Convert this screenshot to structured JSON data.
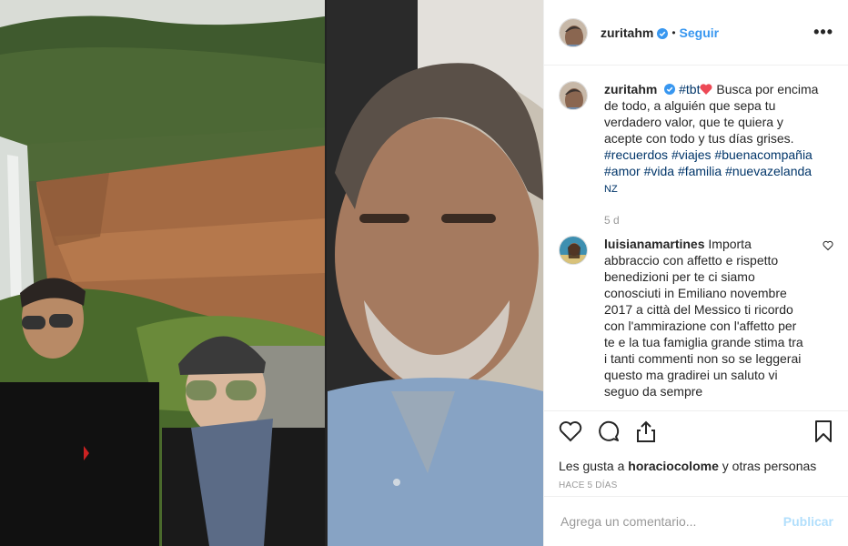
{
  "post": {
    "username": "zuritahm",
    "follow_label": "Seguir",
    "dot": "•",
    "more_label": "•••",
    "caption_pre_tag": "#tbt",
    "caption_text": " Busca por encima de todo, a alguién que sepa tu verdadero valor, que te quiera y acepte con todo y tus días grises.",
    "hashtags": [
      "#recuerdos",
      "#viajes",
      "#buenacompañia",
      "#amor",
      "#vida",
      "#familia",
      "#nuevazelanda"
    ],
    "location_code": "NZ",
    "caption_time": "5 d"
  },
  "comment": {
    "username": "luisianamartines",
    "text": "Importa abbraccio con affetto e rispetto benedizioni per te ci siamo conosciuti in Emiliano novembre 2017 a città del Messico ti ricordo con l'ammirazione con l'affetto per te e la tua famiglia grande stima tra i tanti commenti non so se leggerai questo ma gradirei un saluto vi seguo da sempre"
  },
  "likes": {
    "prefix": "Les gusta a ",
    "user": "horaciocolome",
    "suffix": " y otras personas"
  },
  "posted_ago": "HACE 5 DÍAS",
  "add_comment": {
    "placeholder": "Agrega un comentario...",
    "post_label": "Publicar"
  },
  "colors": {
    "link_blue": "#3897f0",
    "hashtag": "#003569",
    "heart_red": "#ed4956",
    "publish_disabled": "#b2dffc"
  },
  "icons": [
    "verified-icon",
    "more-options-icon",
    "like-heart-icon",
    "comment-icon",
    "share-icon",
    "bookmark-icon",
    "comment-like-heart-icon"
  ]
}
